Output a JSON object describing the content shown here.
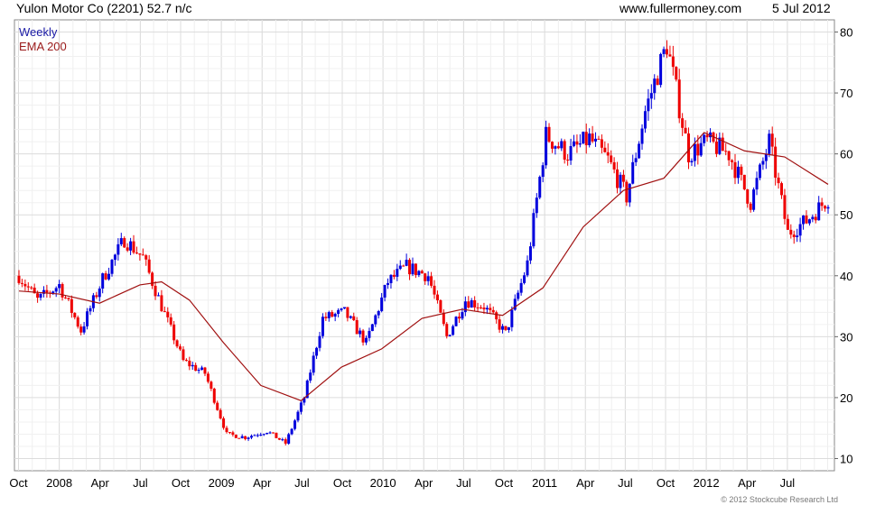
{
  "header": {
    "title": "Yulon Motor Co (2201) 52.7 n/c",
    "site": "www.fullermoney.com",
    "date": "5 Jul 2012"
  },
  "legend": [
    {
      "label": "Weekly",
      "color": "#1a1aa6"
    },
    {
      "label": "EMA 200",
      "color": "#9a1a1a"
    }
  ],
  "copyright": "© 2012 Stockcube Research Ltd",
  "colors": {
    "up": "#0000dd",
    "down": "#ee0000",
    "ema": "#a01010",
    "grid": "#dcdcdc"
  },
  "chart_data": {
    "type": "line",
    "ylim": [
      8,
      82
    ],
    "yticks": [
      10,
      20,
      30,
      40,
      50,
      60,
      70,
      80
    ],
    "xticks": [
      "Oct",
      "2008",
      "Apr",
      "Jul",
      "Oct",
      "2009",
      "Apr",
      "Jul",
      "Oct",
      "2010",
      "Apr",
      "Jul",
      "Oct",
      "2011",
      "Apr",
      "Jul",
      "Oct",
      "2012",
      "Apr",
      "Jul"
    ],
    "x_start": "2007-07-02",
    "x_end": "2012-07-02",
    "grid": true,
    "legend_position": "top-left",
    "series": [
      {
        "name": "Weekly",
        "style": "candlestick",
        "x": [
          "2007-07-02",
          "2007-08-13",
          "2007-10-01",
          "2007-11-19",
          "2008-01-07",
          "2008-02-25",
          "2008-04-07",
          "2008-05-19",
          "2008-07-07",
          "2008-08-25",
          "2008-10-13",
          "2008-11-24",
          "2009-01-12",
          "2009-02-23",
          "2009-04-06",
          "2009-05-18",
          "2009-07-06",
          "2009-08-24",
          "2009-10-12",
          "2009-11-23",
          "2010-01-11",
          "2010-02-22",
          "2010-04-05",
          "2010-05-17",
          "2010-07-05",
          "2010-08-23",
          "2010-10-04",
          "2010-11-22",
          "2011-01-10",
          "2011-02-21",
          "2011-04-04",
          "2011-05-16",
          "2011-07-04",
          "2011-08-22",
          "2011-10-03",
          "2011-11-21",
          "2012-01-09",
          "2012-02-20",
          "2012-04-02",
          "2012-05-14",
          "2012-07-02"
        ],
        "values": [
          40.0,
          36.0,
          38.5,
          31.0,
          39.5,
          46.0,
          43.0,
          35.0,
          26.0,
          24.0,
          14.0,
          13.5,
          14.5,
          12.5,
          20.0,
          33.0,
          34.0,
          29.0,
          39.0,
          41.5,
          40.0,
          30.0,
          36.0,
          35.0,
          30.5,
          42.0,
          63.0,
          60.0,
          62.5,
          59.0,
          53.0,
          67.0,
          78.0,
          60.0,
          62.0,
          60.0,
          52.0,
          62.0,
          47.0,
          49.0,
          52.7
        ]
      },
      {
        "name": "EMA 200",
        "x": [
          "2007-07-02",
          "2007-10-01",
          "2007-12-31",
          "2008-03-31",
          "2008-05-19",
          "2008-07-21",
          "2008-10-06",
          "2008-12-29",
          "2009-03-30",
          "2009-06-29",
          "2009-09-28",
          "2009-12-28",
          "2010-03-29",
          "2010-06-28",
          "2010-09-27",
          "2010-12-27",
          "2011-03-28",
          "2011-06-27",
          "2011-09-26",
          "2011-12-26",
          "2012-03-26",
          "2012-07-02"
        ],
        "values": [
          37.5,
          37.0,
          35.5,
          38.5,
          39.0,
          36.0,
          29.0,
          22.0,
          19.5,
          25.0,
          28.0,
          33.0,
          34.5,
          33.5,
          38.0,
          48.0,
          54.0,
          56.0,
          63.5,
          60.5,
          59.5,
          55.0
        ]
      }
    ]
  }
}
